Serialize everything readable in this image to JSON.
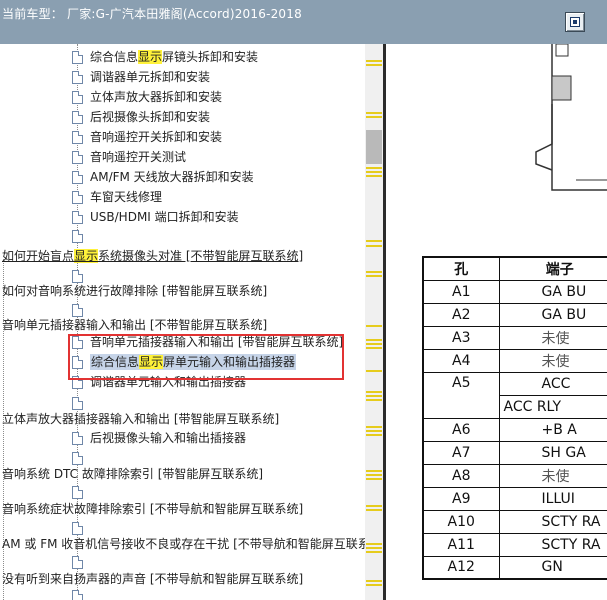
{
  "header": {
    "title": "当前车型： 厂家:G-广汽本田雅阁(Accord)2016-2018"
  },
  "tree": {
    "search_highlight": "显示",
    "items": [
      {
        "pre": "综合信息",
        "hl": "显示",
        "post": "屏镜头拆卸和安装"
      },
      {
        "pre": "调谐器单元拆卸和安装",
        "hl": "",
        "post": ""
      },
      {
        "pre": "立体声放大器拆卸和安装",
        "hl": "",
        "post": ""
      },
      {
        "pre": "后视摄像头拆卸和安装",
        "hl": "",
        "post": ""
      },
      {
        "pre": "音响遥控开关拆卸和安装",
        "hl": "",
        "post": ""
      },
      {
        "pre": "音响遥控开关测试",
        "hl": "",
        "post": ""
      },
      {
        "pre": "AM/FM 天线放大器拆卸和安装",
        "hl": "",
        "post": ""
      },
      {
        "pre": "车窗天线修理",
        "hl": "",
        "post": ""
      },
      {
        "pre": "USB/HDMI 端口拆卸和安装",
        "hl": "",
        "post": ""
      },
      {
        "pre": "如何开始盲点",
        "hl": "显示",
        "post": "系统摄像头对准 [不带智能屏互联系统]"
      },
      {
        "pre": "如何对音响系统进行故障排除 [带智能屏互联系统]",
        "hl": "",
        "post": ""
      },
      {
        "pre": "音响单元插接器输入和输出 [不带智能屏互联系统]",
        "hl": "",
        "post": ""
      },
      {
        "pre": "音响单元插接器输入和输出 [带智能屏互联系统]",
        "hl": "",
        "post": ""
      },
      {
        "pre": "综合信息",
        "hl": "显示",
        "post": "屏单元输入和输出插接器"
      },
      {
        "pre": "调谐器单元输入和输出插接器",
        "hl": "",
        "post": ""
      },
      {
        "pre": "立体声放大器插接器输入和输出 [带智能屏互联系统]",
        "hl": "",
        "post": ""
      },
      {
        "pre": "后视摄像头输入和输出插接器",
        "hl": "",
        "post": ""
      },
      {
        "pre": "音响系统 DTC 故障排除索引 [带智能屏互联系统]",
        "hl": "",
        "post": ""
      },
      {
        "pre": "音响系统症状故障排除索引 [不带导航和智能屏互联系统]",
        "hl": "",
        "post": ""
      },
      {
        "pre": "AM 或 FM 收音机信号接收不良或存在干扰 [不带导航和智能屏互联系统]",
        "hl": "",
        "post": ""
      },
      {
        "pre": "没有听到来自扬声器的声音 [不带导航和智能屏互联系统]",
        "hl": "",
        "post": ""
      }
    ]
  },
  "connector_table": {
    "headers": [
      "孔",
      "端子"
    ],
    "rows": [
      {
        "pin": "A1",
        "terminal": "GA BU"
      },
      {
        "pin": "A2",
        "terminal": "GA BU"
      },
      {
        "pin": "A3",
        "terminal": "未使"
      },
      {
        "pin": "A4",
        "terminal": "未使"
      },
      {
        "pin": "A5",
        "terminal": "ACC"
      },
      {
        "pin": "",
        "terminal": "ACC RLY"
      },
      {
        "pin": "A6",
        "terminal": "+B A"
      },
      {
        "pin": "A7",
        "terminal": "SH GA"
      },
      {
        "pin": "A8",
        "terminal": "未使"
      },
      {
        "pin": "A9",
        "terminal": "ILLUI"
      },
      {
        "pin": "A10",
        "terminal": "SCTY RA"
      },
      {
        "pin": "A11",
        "terminal": "SCTY RA"
      },
      {
        "pin": "A12",
        "terminal": "GN"
      }
    ]
  }
}
